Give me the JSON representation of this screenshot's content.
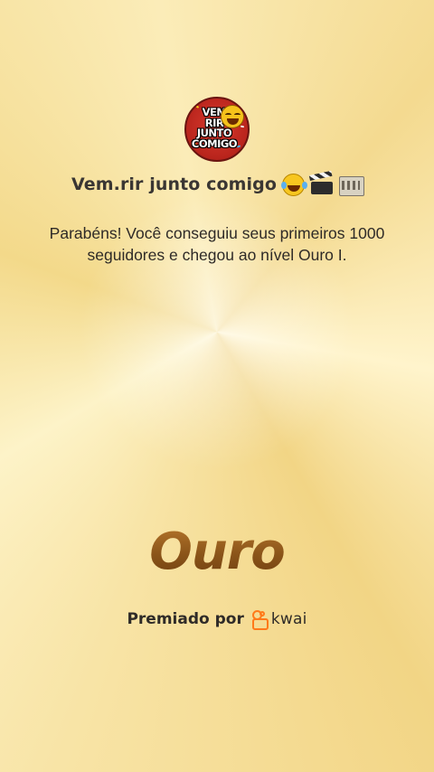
{
  "channel": {
    "avatar_text": "VEM\nRIR\nJUNTO\nCOMIGO",
    "name": "Vem.rir junto comigo",
    "name_emojis": [
      "laughing-tears-emoji",
      "clapper-board-emoji",
      "film-frames-emoji"
    ]
  },
  "message": "Parabéns! Você conseguiu seus primeiros 1000 seguidores e chegou ao nível Ouro I.",
  "level": "Ouro",
  "award": {
    "label": "Premiado por",
    "brand": "kwai",
    "brand_color": "#ff7a1a"
  },
  "colors": {
    "background": "#f8e4a6",
    "level_text": "#8a5419"
  }
}
